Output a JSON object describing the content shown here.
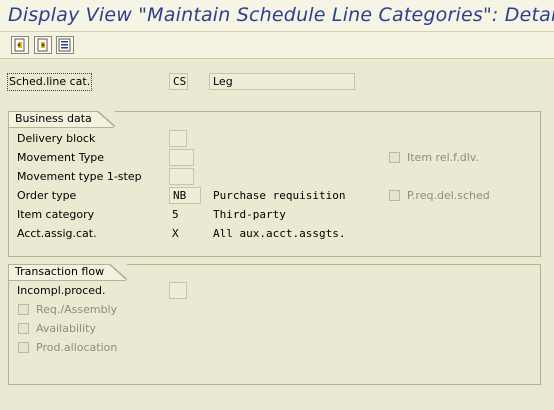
{
  "window": {
    "title": "Display View \"Maintain Schedule Line Categories\": Details"
  },
  "toolbar": {
    "buttons": [
      "previous-entry-icon",
      "next-entry-icon",
      "variable-list-icon"
    ]
  },
  "header": {
    "schedline_label": "Sched.line cat.",
    "schedline_value": "CS",
    "schedline_desc": "Leg"
  },
  "business_data": {
    "title": "Business data",
    "delivery_block": {
      "label": "Delivery block",
      "value": ""
    },
    "movement_type": {
      "label": "Movement Type",
      "value": ""
    },
    "movement_type_1step": {
      "label": "Movement type 1-step",
      "value": ""
    },
    "order_type": {
      "label": "Order type",
      "value": "NB",
      "desc": "Purchase requisition"
    },
    "item_category": {
      "label": "Item category",
      "value": "5",
      "desc": "Third-party"
    },
    "acct_assig": {
      "label": "Acct.assig.cat.",
      "value": "X",
      "desc": "All aux.acct.assgts."
    },
    "item_rel_f_dlv": {
      "label": "Item rel.f.dlv.",
      "checked": false
    },
    "p_req_del_sched": {
      "label": "P.req.del.sched",
      "checked": false
    }
  },
  "transaction_flow": {
    "title": "Transaction flow",
    "incompl_proced": {
      "label": "Incompl.proced.",
      "value": ""
    },
    "req_assembly": {
      "label": "Req./Assembly",
      "checked": false
    },
    "availability": {
      "label": "Availability",
      "checked": false
    },
    "prod_allocation": {
      "label": "Prod.allocation",
      "checked": false
    }
  }
}
